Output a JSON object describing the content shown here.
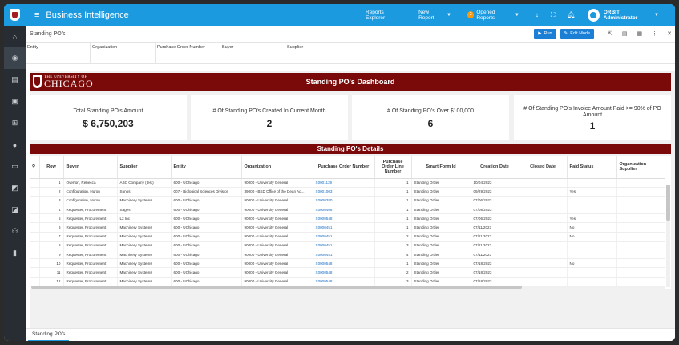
{
  "app": {
    "title": "Business Intelligence",
    "hamburger_glyph": "≡"
  },
  "topnav": {
    "reports_explorer": "Reports Explorer",
    "new_report": "New Report",
    "opened_reports": "Opened Reports",
    "opened_count": "2",
    "user": "ORBIT Administrator"
  },
  "sidebar_icons": [
    "home-icon",
    "target-icon",
    "document-icon",
    "gift-icon",
    "expand-icon",
    "user-icon",
    "monitor-icon",
    "chart-icon",
    "report-icon",
    "users-icon",
    "server-icon"
  ],
  "page": {
    "title": "Standing PO's",
    "run_label": "Run",
    "edit_mode_label": "Edit Mode"
  },
  "filters": [
    "Entity",
    "Organization",
    "Purchase Order Number",
    "Buyer",
    "Supplier"
  ],
  "banner": {
    "title": "Standing PO's Dashboard",
    "logo_small": "THE UNIVERSITY OF",
    "logo_big": "CHICAGO"
  },
  "kpis": [
    {
      "label": "Total Standing PO's Amount",
      "value": "$ 6,750,203"
    },
    {
      "label": "# Of Standing PO's Created In Current Month",
      "value": "2"
    },
    {
      "label": "# Of Standing PO's Over $100,000",
      "value": "6"
    },
    {
      "label": "# Of Standing PO's Invoice Amount Paid >= 90% of PO Amount",
      "value": "1"
    }
  ],
  "details_title": "Standing PO's Details",
  "table": {
    "columns": [
      "Row",
      "Buyer",
      "Supplier",
      "Entity",
      "Organization",
      "Purchase Order Number",
      "Purchase Order Line Number",
      "Smart Form Id",
      "Creation Date",
      "Closed Date",
      "Paid Status",
      "Organization Supplier"
    ],
    "rows": [
      [
        "1",
        "Overton, Rebecca",
        "ABC Company (test)",
        "600 - UChicago",
        "90000 - University General",
        "X0001139",
        "1",
        "Standing Order",
        "10/04/2023",
        "",
        ""
      ],
      [
        "2",
        "Configuration, Huron",
        "Sonos",
        "007 - Biological Sciences Division",
        "39000 - BSD Office of the Dean Ad...",
        "X0001003",
        "1",
        "Standing Order",
        "09/29/2023",
        "",
        "Yes"
      ],
      [
        "3",
        "Configuration, Huron",
        "Machinery Systems",
        "600 - UChicago",
        "90000 - University General",
        "X0000380",
        "1",
        "Standing Order",
        "07/06/2023",
        "",
        ""
      ],
      [
        "4",
        "Requester, Procurement",
        "Sages",
        "600 - UChicago",
        "90000 - University General",
        "X0000408",
        "1",
        "Standing Order",
        "07/08/2023",
        "",
        ""
      ],
      [
        "5",
        "Requester, Procurement",
        "L2 Inc",
        "600 - UChicago",
        "90000 - University General",
        "X0000548",
        "1",
        "Standing Order",
        "07/06/2023",
        "",
        "Yes"
      ],
      [
        "6",
        "Requester, Procurement",
        "Machinery Systems",
        "600 - UChicago",
        "90000 - University General",
        "X0000451",
        "1",
        "Standing Order",
        "07/11/2023",
        "",
        "No"
      ],
      [
        "7",
        "Requester, Procurement",
        "Machinery Systems",
        "600 - UChicago",
        "90000 - University General",
        "X0000451",
        "2",
        "Standing Order",
        "07/11/2023",
        "",
        "No"
      ],
      [
        "8",
        "Requester, Procurement",
        "Machinery Systems",
        "600 - UChicago",
        "90000 - University General",
        "X0000451",
        "3",
        "Standing Order",
        "07/11/2023",
        "",
        ""
      ],
      [
        "9",
        "Requester, Procurement",
        "Machinery Systems",
        "600 - UChicago",
        "90000 - University General",
        "X0000451",
        "4",
        "Standing Order",
        "07/11/2023",
        "",
        ""
      ],
      [
        "10",
        "Requester, Procurement",
        "Machinery Systems",
        "600 - UChicago",
        "90000 - University General",
        "X0000548",
        "1",
        "Standing Order",
        "07/18/2023",
        "",
        "No"
      ],
      [
        "11",
        "Requester, Procurement",
        "Machinery Systems",
        "600 - UChicago",
        "90000 - University General",
        "X0000548",
        "2",
        "Standing Order",
        "07/18/2023",
        "",
        ""
      ],
      [
        "12",
        "Requester, Procurement",
        "Machinery Systems",
        "600 - UChicago",
        "90000 - University General",
        "X0000548",
        "3",
        "Standing Order",
        "07/18/2023",
        "",
        ""
      ]
    ]
  },
  "bottom_tab": "Standing PO's",
  "colors": {
    "accent": "#1b9ae0",
    "brand_maroon": "#7a0a0a",
    "sidebar": "#272d33"
  }
}
